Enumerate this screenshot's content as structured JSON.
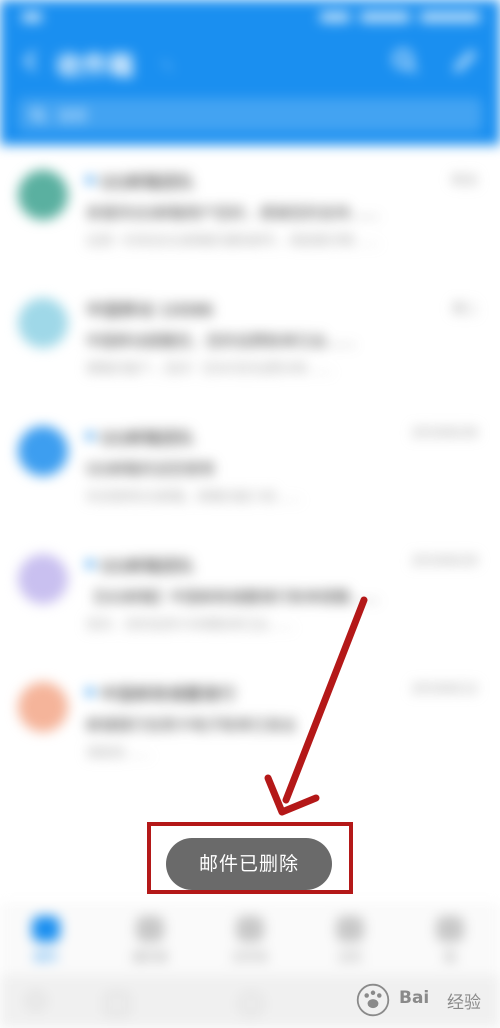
{
  "header": {
    "title": "收件箱",
    "title_suffix": "ㄟ",
    "search_placeholder": "搜索"
  },
  "mails": [
    {
      "sender": "QQ邮箱团队",
      "date": "昨天",
      "subject": "亲爱的QQ邮箱用户您好，感谢您的支持……",
      "preview": "这是一封来自QQ邮箱的通知邮件，请查看详情……",
      "avatar_color": "#5ab0a0",
      "unread": true
    },
    {
      "sender": "中国移动 10086",
      "date": "周二",
      "subject": "中国移动提醒您，您的话费账单已出……",
      "preview": "尊敬的客户，您好！您本月的话费详单……",
      "avatar_color": "#9fd8e8",
      "unread": false
    },
    {
      "sender": "QQ邮箱团队",
      "date": "2019/6/26",
      "subject": "QQ邮箱欢迎您使用",
      "preview": "欢迎使用QQ邮箱，邮箱功能介绍……",
      "avatar_color": "#3d9ef0",
      "unread": true
    },
    {
      "sender": "QQ邮箱团队",
      "date": "2019/6/20",
      "subject": "【QQ邮箱】中国邮政储蓄银行账单提醒……",
      "preview": "您好，您的信用卡本期账单已出……",
      "avatar_color": "#c9c0f0",
      "unread": true
    },
    {
      "sender": "中国邮政储蓄银行",
      "date": "2019/6/12",
      "subject": "邮储银行信用卡电子账单已发出",
      "preview": "请查收……",
      "avatar_color": "#f5b49a",
      "unread": true
    }
  ],
  "bottom_nav": [
    {
      "label": "邮件",
      "active": true
    },
    {
      "label": "通讯录",
      "active": false
    },
    {
      "label": "文件夹",
      "active": false
    },
    {
      "label": "日历",
      "active": false
    },
    {
      "label": "我",
      "active": false
    }
  ],
  "toast": {
    "text": "邮件已删除"
  },
  "annotation": {
    "color": "#b41818"
  },
  "watermark": {
    "brand": "Bai",
    "suffix": "经验"
  },
  "colors": {
    "accent": "#1a8ff0",
    "toast_bg": "#6a6a6a"
  }
}
